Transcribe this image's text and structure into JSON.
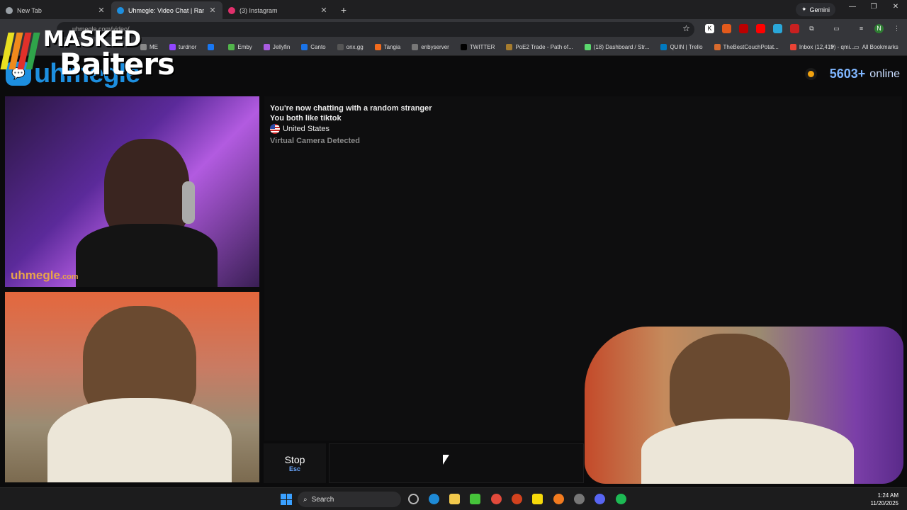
{
  "tabs": [
    {
      "title": "New Tab",
      "fav": "#9aa0a6",
      "active": false
    },
    {
      "title": "Uhmegle: Video Chat | Rand",
      "fav": "#1d8fe0",
      "active": true
    },
    {
      "title": "(3) Instagram",
      "fav": "#e1306c",
      "active": false
    }
  ],
  "gemini_label": "Gemini",
  "window_controls": {
    "minimize": "—",
    "restore": "❐",
    "close": "✕"
  },
  "url": "uhmegle.com/video/",
  "bookmarks": [
    {
      "label": "ME",
      "color": "#888"
    },
    {
      "label": "turdnor",
      "color": "#9146ff"
    },
    {
      "label": "",
      "color": "#1877f2"
    },
    {
      "label": "Emby",
      "color": "#52b54b"
    },
    {
      "label": "Jellyfin",
      "color": "#a95ce0"
    },
    {
      "label": "Canto",
      "color": "#1a73e8"
    },
    {
      "label": "onx.gg",
      "color": "#555"
    },
    {
      "label": "Tangia",
      "color": "#f26b1d"
    },
    {
      "label": "enbyserver",
      "color": "#777"
    },
    {
      "label": "TWITTER",
      "color": "#000"
    },
    {
      "label": "PoE2 Trade - Path of...",
      "color": "#a67c2e"
    },
    {
      "label": "(18) Dashboard / Str...",
      "color": "#5bd86e"
    },
    {
      "label": "QUIN | Trello",
      "color": "#0079bf"
    },
    {
      "label": "TheBestCouchPotat...",
      "color": "#d86b2e"
    },
    {
      "label": "Inbox (12,419) - qmi...",
      "color": "#ea4335"
    }
  ],
  "bookmarks_more": "»",
  "all_bookmarks": "All Bookmarks",
  "site": {
    "logo_word": "uhmegle",
    "online_count": "5603+",
    "online_label": "online"
  },
  "overlay": {
    "line1": "MASKED",
    "line2": "Baiters"
  },
  "watermark": {
    "name": "uhmegle",
    "tld": ".com"
  },
  "chat": {
    "line1": "You're now chatting with a random stranger",
    "line2": "You both like tiktok",
    "country": "United States",
    "notice": "Virtual Camera Detected"
  },
  "stop": {
    "label": "Stop",
    "key": "Esc"
  },
  "taskbar": {
    "search": "Search",
    "time": "1:24 AM",
    "date": "11/20/2025"
  }
}
